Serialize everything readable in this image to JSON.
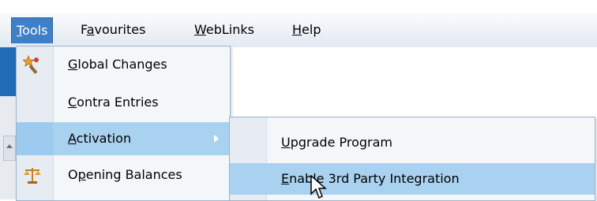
{
  "menubar": {
    "items": [
      {
        "label": "Tools",
        "mnemonic": "T",
        "rest": "ools",
        "active": true
      },
      {
        "label": "Favourites",
        "pre": "F",
        "mnemonic": "a",
        "rest": "vourites"
      },
      {
        "label": "WebLinks",
        "mnemonic": "W",
        "rest": "ebLinks"
      },
      {
        "label": "Help",
        "mnemonic": "H",
        "rest": "elp"
      }
    ]
  },
  "tools_menu": {
    "items": [
      {
        "label": "Global Changes",
        "mnemonic": "G",
        "rest": "lobal Changes",
        "icon": "global-changes-icon"
      },
      {
        "label": "Contra Entries",
        "mnemonic": "C",
        "rest": "ontra Entries"
      },
      {
        "label": "Activation",
        "mnemonic": "A",
        "rest": "ctivation",
        "has_submenu": true,
        "highlighted": true
      },
      {
        "label": "Opening Balances",
        "pre": "O",
        "mnemonic": "p",
        "rest": "ening Balances",
        "icon": "scales-icon"
      }
    ]
  },
  "activation_submenu": {
    "items": [
      {
        "label": "Upgrade Program",
        "mnemonic": "U",
        "rest": "pgrade Program"
      },
      {
        "label": "Enable 3rd Party Integration",
        "mnemonic": "E",
        "rest": "nable 3rd Party Integration",
        "highlighted": true
      }
    ]
  },
  "colors": {
    "menubar_active": "#3f7fc7",
    "highlight": "#a9d2f0",
    "menu_bg": "#f4f7fa"
  }
}
